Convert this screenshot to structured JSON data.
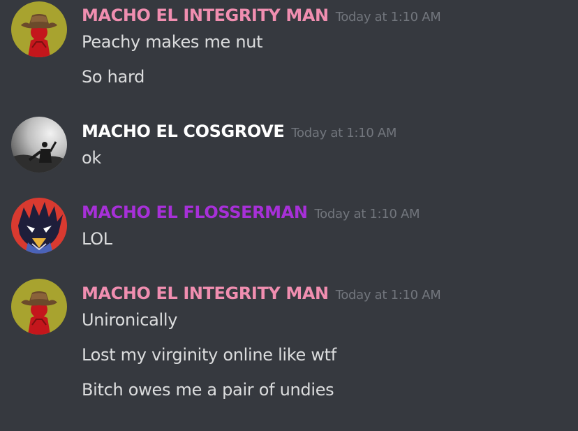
{
  "colors": {
    "background": "#36393f",
    "text": "#dcddde",
    "timestamp": "#72767d",
    "pink_role": "#f08eb0",
    "white_role": "#ffffff",
    "purple_role": "#a730d8"
  },
  "messages": [
    {
      "avatar_icon": "cowboy-hat-avatar-icon",
      "username": "MACHO EL INTEGRITY MAN",
      "timestamp": "Today at 1:10 AM",
      "lines": [
        "Peachy makes me nut",
        "So hard"
      ]
    },
    {
      "avatar_icon": "concert-photo-avatar-icon",
      "username": "MACHO EL COSGROVE",
      "timestamp": "Today at 1:10 AM",
      "lines": [
        "ok"
      ]
    },
    {
      "avatar_icon": "anime-character-avatar-icon",
      "username": "MACHO EL FLOSSERMAN",
      "timestamp": "Today at 1:10 AM",
      "lines": [
        "LOL"
      ]
    },
    {
      "avatar_icon": "cowboy-hat-avatar-icon",
      "username": "MACHO EL INTEGRITY MAN",
      "timestamp": "Today at 1:10 AM",
      "lines": [
        "Unironically",
        "Lost my virginity online like wtf",
        "Bitch owes me a pair of undies"
      ]
    }
  ]
}
